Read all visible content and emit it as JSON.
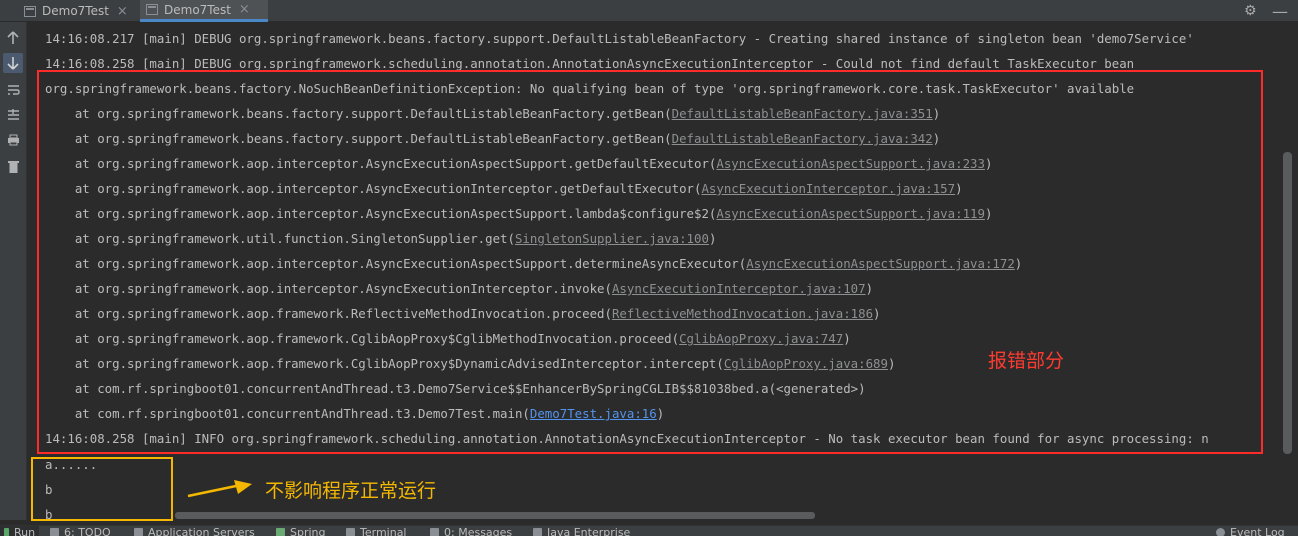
{
  "tabs": [
    {
      "label": "Demo7Test",
      "close": "×"
    },
    {
      "label": "Demo7Test",
      "close": "×"
    }
  ],
  "window_controls": {
    "gear": "⚙",
    "minimize": "—"
  },
  "toolbar_icons": [
    "arrow-up-icon",
    "arrow-down-icon",
    "soft-wrap-icon",
    "scroll-to-end-icon",
    "print-icon",
    "trash-icon"
  ],
  "console": {
    "log1": "14:16:08.217 [main] DEBUG org.springframework.beans.factory.support.DefaultListableBeanFactory - Creating shared instance of singleton bean 'demo7Service'",
    "log2": "14:16:08.258 [main] DEBUG org.springframework.scheduling.annotation.AnnotationAsyncExecutionInterceptor - Could not find default TaskExecutor bean",
    "exception": "org.springframework.beans.factory.NoSuchBeanDefinitionException: No qualifying bean of type 'org.springframework.core.task.TaskExecutor' available",
    "stack": [
      {
        "prefix": "    at org.springframework.beans.factory.support.DefaultListableBeanFactory.getBean(",
        "link": "DefaultListableBeanFactory.java:351",
        "suffix": ")"
      },
      {
        "prefix": "    at org.springframework.beans.factory.support.DefaultListableBeanFactory.getBean(",
        "link": "DefaultListableBeanFactory.java:342",
        "suffix": ")"
      },
      {
        "prefix": "    at org.springframework.aop.interceptor.AsyncExecutionAspectSupport.getDefaultExecutor(",
        "link": "AsyncExecutionAspectSupport.java:233",
        "suffix": ")"
      },
      {
        "prefix": "    at org.springframework.aop.interceptor.AsyncExecutionInterceptor.getDefaultExecutor(",
        "link": "AsyncExecutionInterceptor.java:157",
        "suffix": ")"
      },
      {
        "prefix": "    at org.springframework.aop.interceptor.AsyncExecutionAspectSupport.lambda$configure$2(",
        "link": "AsyncExecutionAspectSupport.java:119",
        "suffix": ")"
      },
      {
        "prefix": "    at org.springframework.util.function.SingletonSupplier.get(",
        "link": "SingletonSupplier.java:100",
        "suffix": ")"
      },
      {
        "prefix": "    at org.springframework.aop.interceptor.AsyncExecutionAspectSupport.determineAsyncExecutor(",
        "link": "AsyncExecutionAspectSupport.java:172",
        "suffix": ")"
      },
      {
        "prefix": "    at org.springframework.aop.interceptor.AsyncExecutionInterceptor.invoke(",
        "link": "AsyncExecutionInterceptor.java:107",
        "suffix": ")"
      },
      {
        "prefix": "    at org.springframework.aop.framework.ReflectiveMethodInvocation.proceed(",
        "link": "ReflectiveMethodInvocation.java:186",
        "suffix": ")"
      },
      {
        "prefix": "    at org.springframework.aop.framework.CglibAopProxy$CglibMethodInvocation.proceed(",
        "link": "CglibAopProxy.java:747",
        "suffix": ")"
      },
      {
        "prefix": "    at org.springframework.aop.framework.CglibAopProxy$DynamicAdvisedInterceptor.intercept(",
        "link": "CglibAopProxy.java:689",
        "suffix": ")"
      },
      {
        "prefix": "    at com.rf.springboot01.concurrentAndThread.t3.Demo7Service$$EnhancerBySpringCGLIB$$81038bed.a(<generated>)",
        "link": "",
        "suffix": ""
      },
      {
        "prefix": "    at com.rf.springboot01.concurrentAndThread.t3.Demo7Test.main(",
        "link": "Demo7Test.java:16",
        "suffix": ")"
      }
    ],
    "log3": "14:16:08.258 [main] INFO org.springframework.scheduling.annotation.AnnotationAsyncExecutionInterceptor - No task executor bean found for async processing: n",
    "outputs": [
      "a......",
      "b",
      "b"
    ]
  },
  "annotations": {
    "error_part": "报错部分",
    "no_effect": "不影响程序正常运行",
    "red_color": "#ff2b2b",
    "yellow_color": "#f5b800"
  },
  "bottom_bar": {
    "run": "Run",
    "todo": "6: TODO",
    "app_servers": "Application Servers",
    "spring": "Spring",
    "terminal": "Terminal",
    "messages": "0: Messages",
    "java_ee": "Java Enterprise",
    "event_log": "Event Log"
  }
}
